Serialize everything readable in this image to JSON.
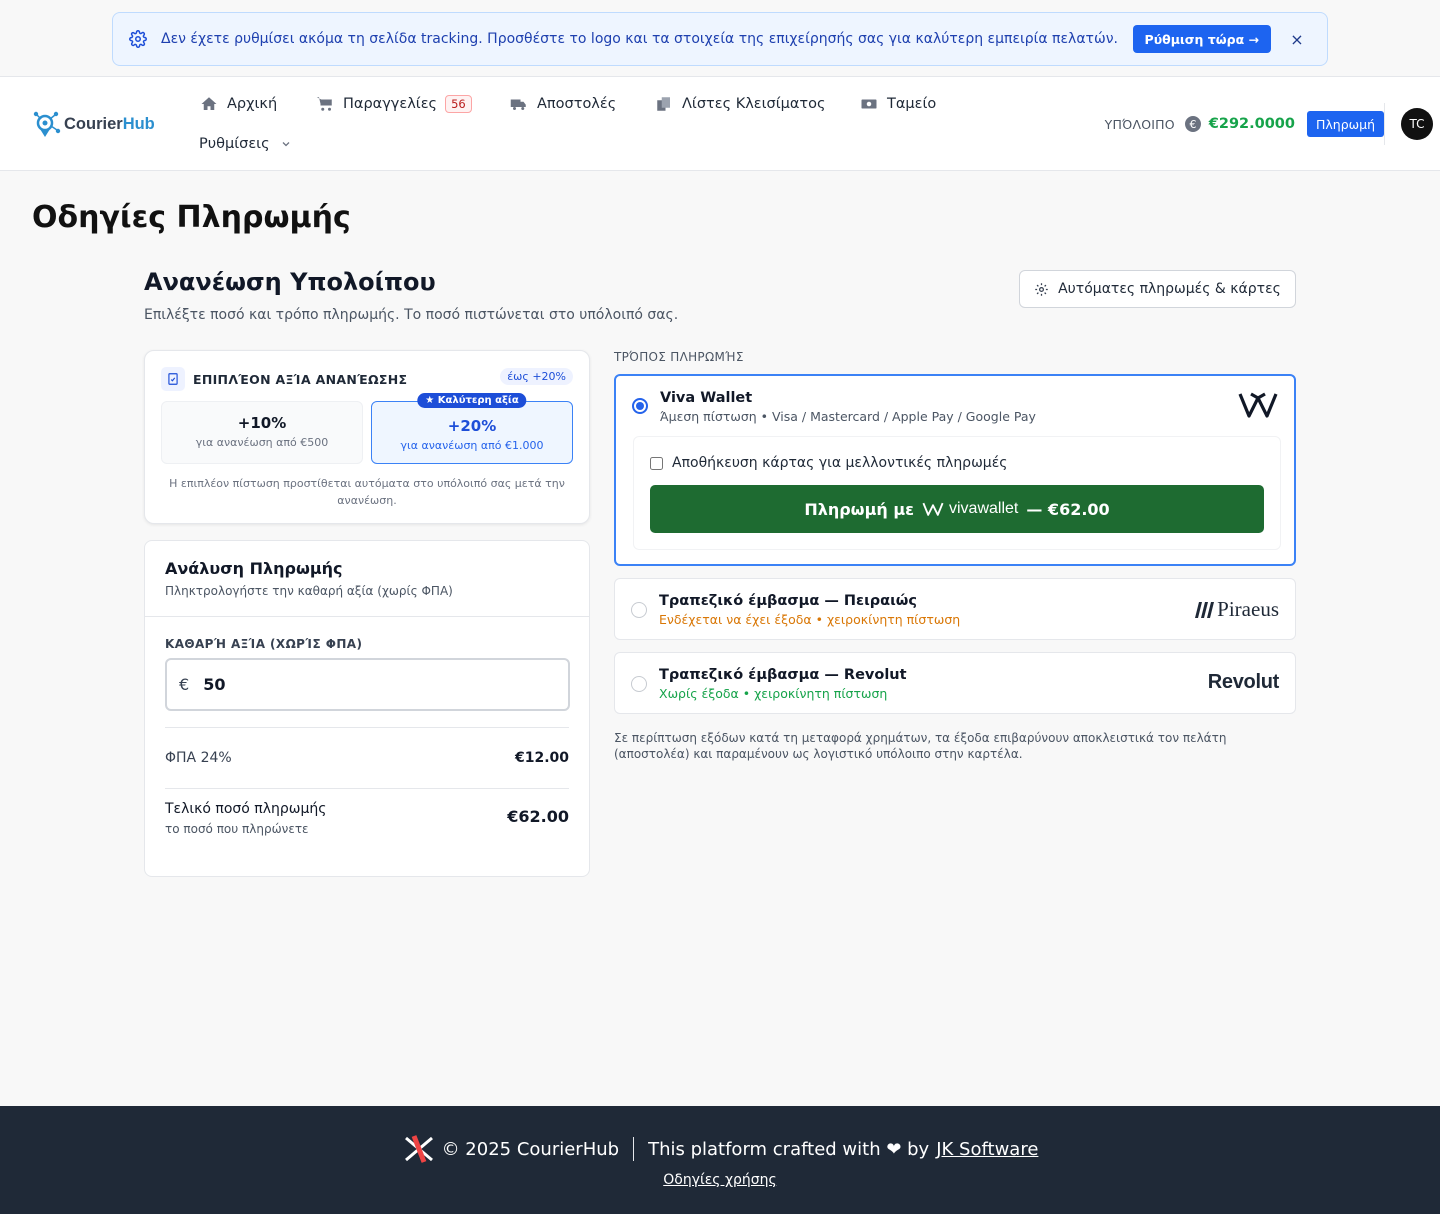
{
  "banner": {
    "text": "Δεν έχετε ρυθμίσει ακόμα τη σελίδα tracking. Προσθέστε το logo και τα στοιχεία της επιχείρησής σας για καλύτερη εμπειρία πελατών.",
    "button": "Ρύθμιση τώρα →",
    "close": "×"
  },
  "brand": {
    "part1": "Courier",
    "part2": "Hub"
  },
  "nav": {
    "home": "Αρχική",
    "orders": "Παραγγελίες",
    "orders_badge": "56",
    "shipments": "Αποστολές",
    "closing_lists": "Λίστες Κλεισίματος",
    "cashier": "Ταμείο",
    "settings": "Ρυθμίσεις"
  },
  "balance": {
    "label": "ΥΠΌΛΟΙΠΟ",
    "amount": "€292.0000",
    "pay_button": "Πληρωμή"
  },
  "user": {
    "initials": "TC"
  },
  "page": {
    "title": "Οδηγίες Πληρωμής"
  },
  "topup": {
    "title": "Ανανέωση Υπολοίπου",
    "subtitle": "Επιλέξτε ποσό και τρόπο πληρωμής. Το ποσό πιστώνεται στο υπόλοιπό σας.",
    "auto_button": "Αυτόματες πληρωμές & κάρτες"
  },
  "bonus": {
    "title": "ΕΠΙΠΛΈΟΝ ΑΞΊΑ ΑΝΑΝΈΩΣΗΣ",
    "tag": "έως +20%",
    "tiers": [
      {
        "pct": "+10%",
        "condition": "για ανανέωση από €500"
      },
      {
        "pct": "+20%",
        "condition": "για ανανέωση από €1.000",
        "badge": "★ Καλύτερη αξία"
      }
    ],
    "note": "Η επιπλέον πίστωση προστίθεται αυτόματα στο υπόλοιπό σας μετά την ανανέωση."
  },
  "breakdown": {
    "title": "Ανάλυση Πληρωμής",
    "subtitle": "Πληκτρολογήστε την καθαρή αξία (χωρίς ΦΠΑ)",
    "net_label": "ΚΑΘΑΡΉ ΑΞΊΑ (ΧΩΡΊΣ ΦΠΑ)",
    "currency": "€",
    "net_value": "50",
    "vat_label": "ΦΠΑ 24%",
    "vat_value": "€12.00",
    "total_label": "Τελικό ποσό πληρωμής",
    "total_sub": "το ποσό που πληρώνετε",
    "total_value": "€62.00"
  },
  "methods": {
    "label": "ΤΡΌΠΟΣ ΠΛΗΡΩΜΉΣ",
    "viva": {
      "title": "Viva Wallet",
      "subtitle": "Άμεση πίστωση • Visa / Mastercard / Apple Pay / Google Pay",
      "save_card": "Αποθήκευση κάρτας για μελλοντικές πληρωμές",
      "pay_prefix": "Πληρωμή με",
      "pay_brand": "vivawallet",
      "pay_suffix": "— €62.00"
    },
    "piraeus": {
      "title": "Τραπεζικό έμβασμα — Πειραιώς",
      "subtitle": "Ενδέχεται να έχει έξοδα • χειροκίνητη πίστωση",
      "logo": "Piraeus"
    },
    "revolut": {
      "title": "Τραπεζικό έμβασμα — Revolut",
      "subtitle": "Χωρίς έξοδα • χειροκίνητη πίστωση",
      "logo": "Revolut"
    },
    "disclaimer": "Σε περίπτωση εξόδων κατά τη μεταφορά χρημάτων, τα έξοδα επιβαρύνουν αποκλειστικά τον πελάτη (αποστολέα) και παραμένουν ως λογιστικό υπόλοιπο στην καρτέλα."
  },
  "footer": {
    "copyright": "© 2025 CourierHub",
    "crafted": "This platform crafted with ❤ by",
    "company": "JK Software",
    "guide": "Οδηγίες χρήσης"
  },
  "colors": {
    "accent": "#1d64f0",
    "success": "#16a34a",
    "viva_green": "#1e6b31",
    "footer_bg": "#1f2937"
  }
}
